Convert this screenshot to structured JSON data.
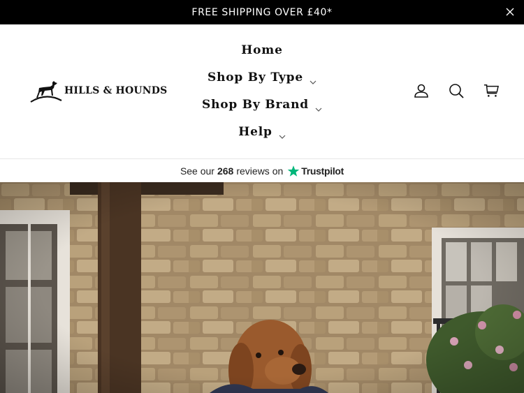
{
  "announcement": {
    "text": "FREE SHIPPING OVER £40*",
    "close_icon": "close-icon"
  },
  "brand": {
    "name": "HILLS & HOUNDS",
    "logo_icon": "dog-logo-icon"
  },
  "nav": {
    "items": [
      {
        "label": "Home",
        "has_dropdown": false
      },
      {
        "label": "Shop By Type",
        "has_dropdown": true
      },
      {
        "label": "Shop By Brand",
        "has_dropdown": true
      },
      {
        "label": "Help",
        "has_dropdown": true
      }
    ]
  },
  "header_icons": [
    "account-icon",
    "search-icon",
    "cart-icon"
  ],
  "trustpilot": {
    "prefix": "See our",
    "count": "268",
    "suffix": "reviews on",
    "brand": "Trustpilot",
    "star_color": "#00b67a"
  },
  "hero": {
    "image": "dog-in-coat-photo"
  },
  "colors": {
    "announcement_bg": "#000000",
    "announcement_text": "#ffffff",
    "nav_text": "#111111"
  }
}
